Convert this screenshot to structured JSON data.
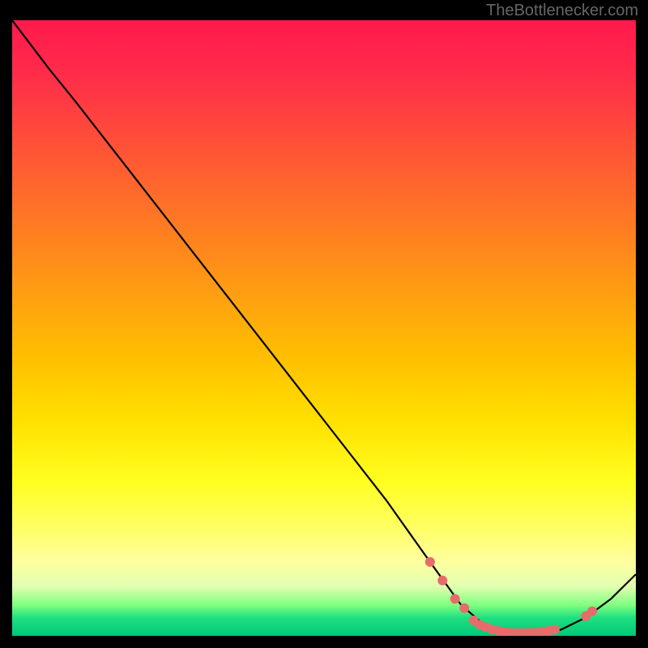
{
  "attribution": "TheBottlenecker.com",
  "chart_data": {
    "type": "line",
    "title": "",
    "xlabel": "",
    "ylabel": "",
    "xlim": [
      0,
      100
    ],
    "ylim": [
      0,
      100
    ],
    "curve": [
      {
        "x": 0,
        "y": 100
      },
      {
        "x": 6,
        "y": 92
      },
      {
        "x": 10,
        "y": 87
      },
      {
        "x": 20,
        "y": 74
      },
      {
        "x": 30,
        "y": 61
      },
      {
        "x": 40,
        "y": 48
      },
      {
        "x": 50,
        "y": 35
      },
      {
        "x": 60,
        "y": 22
      },
      {
        "x": 67,
        "y": 12
      },
      {
        "x": 72,
        "y": 5
      },
      {
        "x": 76,
        "y": 1.5
      },
      {
        "x": 80,
        "y": 0.5
      },
      {
        "x": 84,
        "y": 0.5
      },
      {
        "x": 88,
        "y": 1
      },
      {
        "x": 92,
        "y": 3
      },
      {
        "x": 96,
        "y": 6
      },
      {
        "x": 100,
        "y": 10
      }
    ],
    "markers": [
      {
        "x": 67,
        "y": 12
      },
      {
        "x": 69,
        "y": 9
      },
      {
        "x": 71,
        "y": 6
      },
      {
        "x": 72.5,
        "y": 4.5
      },
      {
        "x": 74,
        "y": 2.5
      },
      {
        "x": 75,
        "y": 1.8
      },
      {
        "x": 76,
        "y": 1.4
      },
      {
        "x": 77,
        "y": 1.0
      },
      {
        "x": 78,
        "y": 0.8
      },
      {
        "x": 79,
        "y": 0.6
      },
      {
        "x": 80,
        "y": 0.5
      },
      {
        "x": 81,
        "y": 0.5
      },
      {
        "x": 82,
        "y": 0.5
      },
      {
        "x": 83,
        "y": 0.5
      },
      {
        "x": 84,
        "y": 0.6
      },
      {
        "x": 85,
        "y": 0.7
      },
      {
        "x": 86,
        "y": 0.8
      },
      {
        "x": 87,
        "y": 1.0
      },
      {
        "x": 92,
        "y": 3.2
      },
      {
        "x": 93,
        "y": 4.0
      }
    ],
    "marker_color": "#e86b6b",
    "line_color": "#000000",
    "gradient_stops": [
      {
        "pos": 0,
        "color": "#ff1a4d"
      },
      {
        "pos": 50,
        "color": "#ffc000"
      },
      {
        "pos": 80,
        "color": "#ffff60"
      },
      {
        "pos": 100,
        "color": "#00c878"
      }
    ]
  }
}
